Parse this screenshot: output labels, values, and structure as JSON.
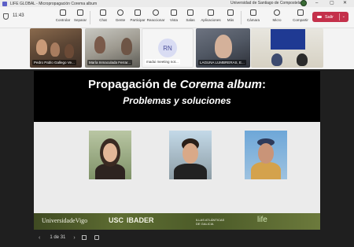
{
  "window": {
    "title": "LIFE GLOBAL - Micropropagación Corema album",
    "organization": "Universidad de Santiago de Compostela",
    "minimize": "–",
    "maximize": "▢",
    "close": "✕"
  },
  "toolbar": {
    "time": "11:43",
    "controlar_label": "Controlar",
    "separar_label": "Separar",
    "chat_label": "Chat",
    "gente_label": "Gente",
    "participar_label": "Participar",
    "reaccionar_label": "Reaccionar",
    "vista_label": "Vista",
    "salas_label": "Salas",
    "aplicaciones_label": "Aplicaciones",
    "mas_label": "Más",
    "camara_label": "Cámara",
    "micro_label": "Micro",
    "compartir_label": "Compartir",
    "salir_label": "Salir",
    "people_count": "5"
  },
  "participants": [
    {
      "name": "Pedro Pablo Gallego Ve..."
    },
    {
      "name": "María Inmaculada Ferrar..."
    },
    {
      "name": "madui meeting not...",
      "initials": "RN"
    },
    {
      "name": "LAGUNA LUMBRERAS, E..."
    },
    {
      "name": ""
    }
  ],
  "slide": {
    "title_prefix": "Propagación de ",
    "title_italic": "Corema album",
    "title_suffix": ":",
    "subtitle": "Problemas y soluciones",
    "logos": {
      "uvigo": "UniversidadeVigo",
      "usc": "USC",
      "ibader": "IBADER",
      "islas": "ILLAS ATLÁNTICAS DE GALICIA",
      "life": "life"
    }
  },
  "pager": {
    "prev": "‹",
    "page_text": "1 de 31",
    "next": "›"
  },
  "colors": {
    "leave_button": "#c4314b",
    "accent": "#5b5fc7"
  }
}
